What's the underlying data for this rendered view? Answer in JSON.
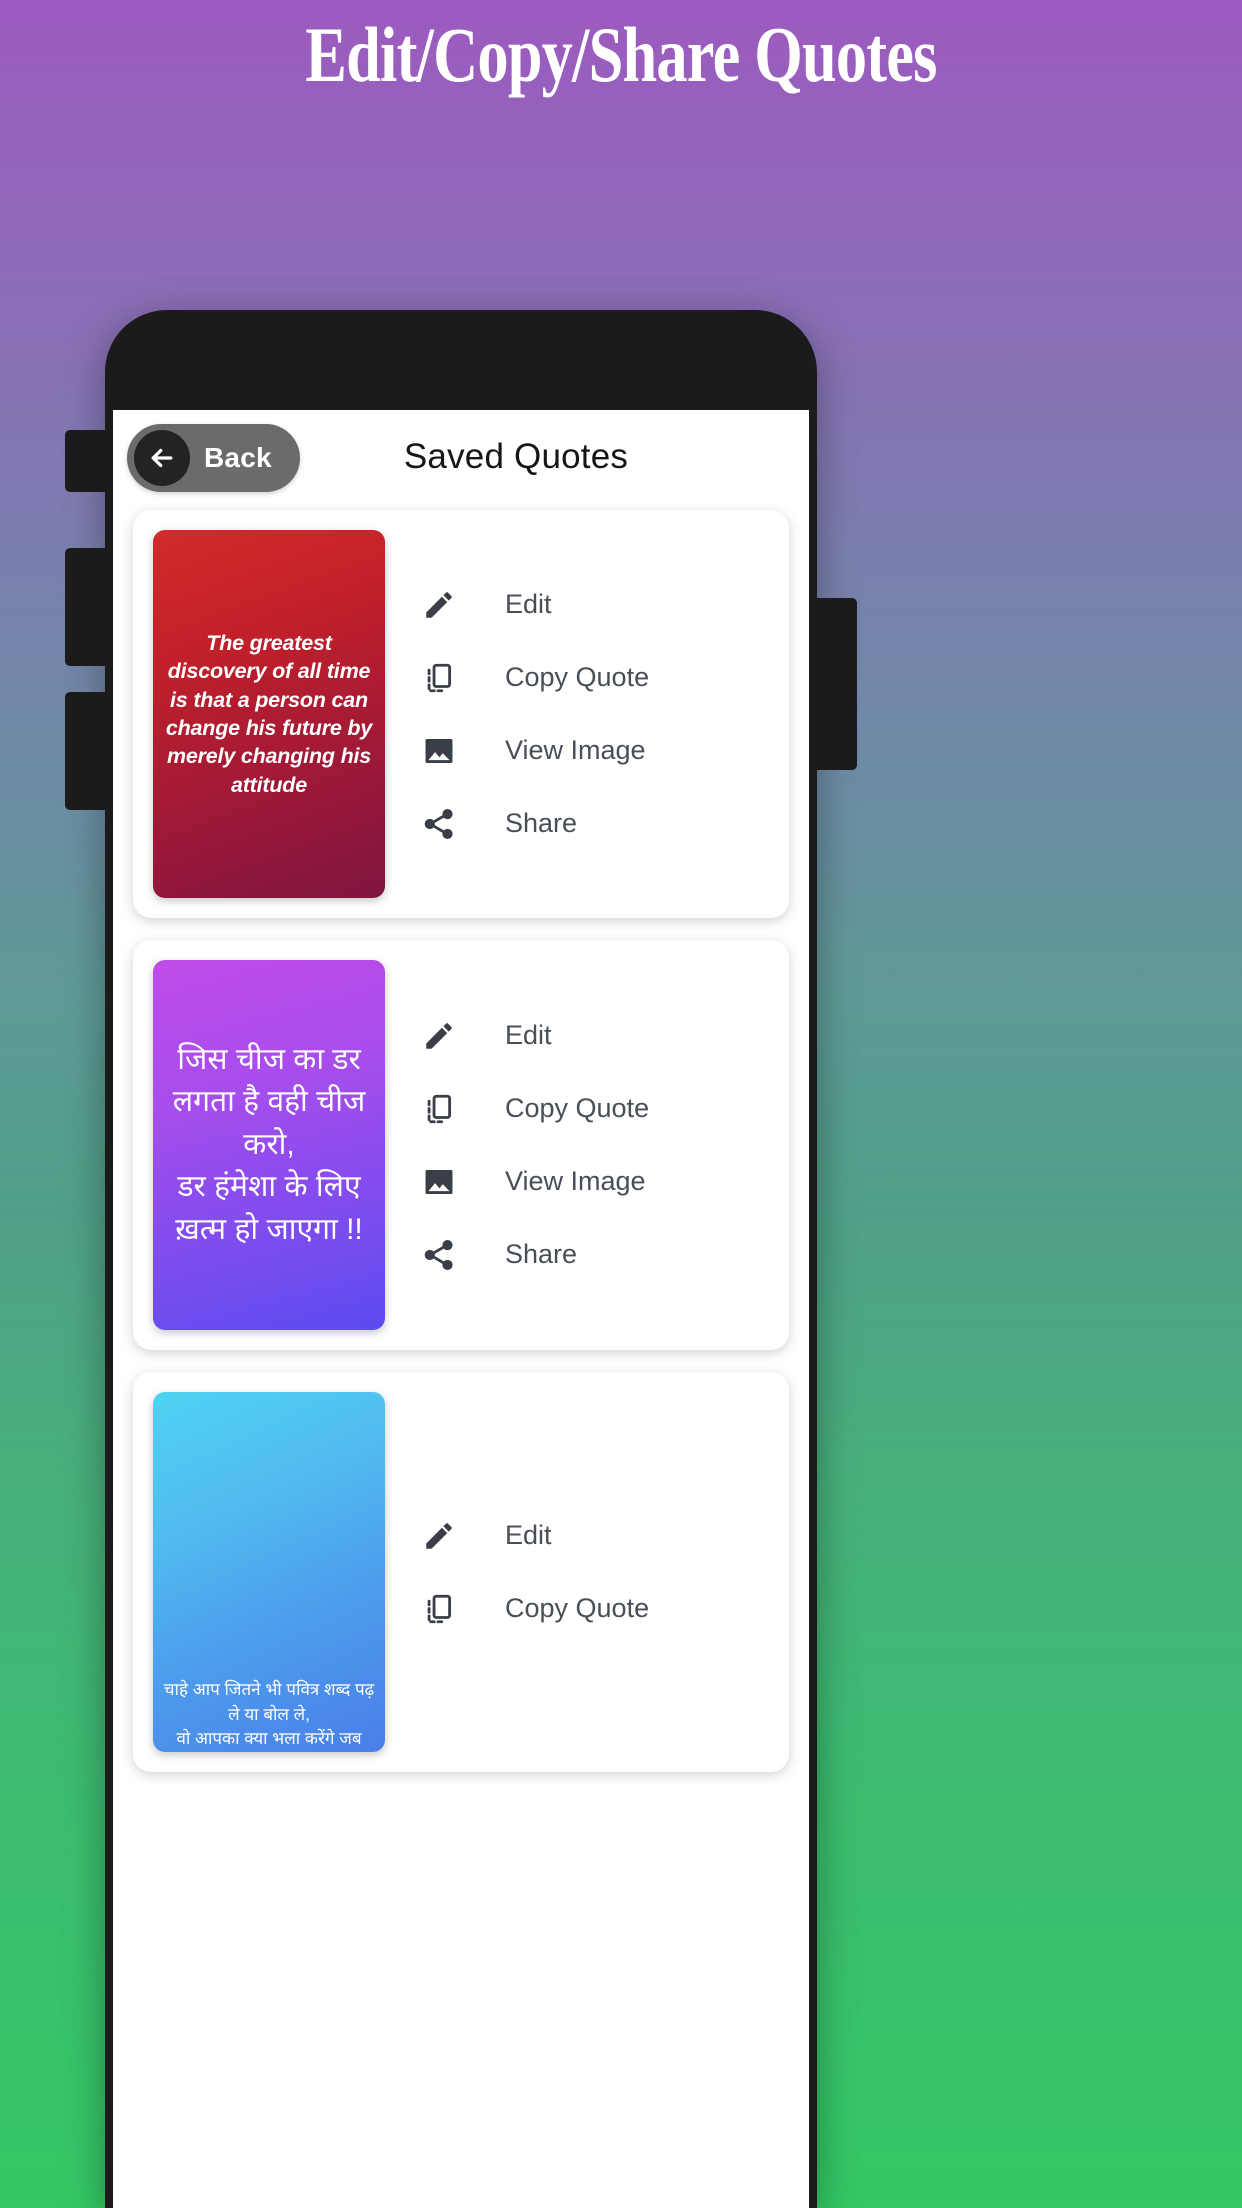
{
  "banner": {
    "title": "Edit/Copy/Share Quotes"
  },
  "colors": {
    "background_top": "#9C5AC0",
    "background_bottom": "#34C764",
    "phone_frame": "#1b1b1b",
    "back_button_pill": "#6b6b6b",
    "back_button_circle": "#232323",
    "icon": "#3a3f47",
    "label": "#494f57"
  },
  "app": {
    "header": {
      "back_label": "Back",
      "back_icon": "arrow-left-icon",
      "title": "Saved Quotes"
    },
    "quotes": [
      {
        "text": "The greatest\ndiscovery of all time\nis that a person can\nchange his future by\nmerely changing his\nattitude",
        "lang": "en",
        "gradient_from": "#D42A2A",
        "gradient_to": "#7E1540",
        "actions": [
          {
            "label": "Edit",
            "icon": "pencil-icon"
          },
          {
            "label": "Copy Quote",
            "icon": "copy-icon"
          },
          {
            "label": "View Image",
            "icon": "image-icon"
          },
          {
            "label": "Share",
            "icon": "share-icon"
          }
        ]
      },
      {
        "text": "जिस चीज का डर\nलगता है वही चीज\nकरो,\nडर हंमेशा के लिए\nख़त्म हो जाएगा !!",
        "lang": "hi",
        "gradient_from": "#C04CE8",
        "gradient_to": "#5B4BEF",
        "actions": [
          {
            "label": "Edit",
            "icon": "pencil-icon"
          },
          {
            "label": "Copy Quote",
            "icon": "copy-icon"
          },
          {
            "label": "View Image",
            "icon": "image-icon"
          },
          {
            "label": "Share",
            "icon": "share-icon"
          }
        ]
      },
      {
        "text": "चाहे आप जितने भी पवित्र शब्द पढ़\nले या बोल ले,\nवो आपका क्या भला करेंगे जब",
        "lang": "hi",
        "gradient_from": "#4DD3F2",
        "gradient_to": "#4A7FE8",
        "actions": [
          {
            "label": "Edit",
            "icon": "pencil-icon"
          },
          {
            "label": "Copy Quote",
            "icon": "copy-icon"
          }
        ]
      }
    ]
  }
}
